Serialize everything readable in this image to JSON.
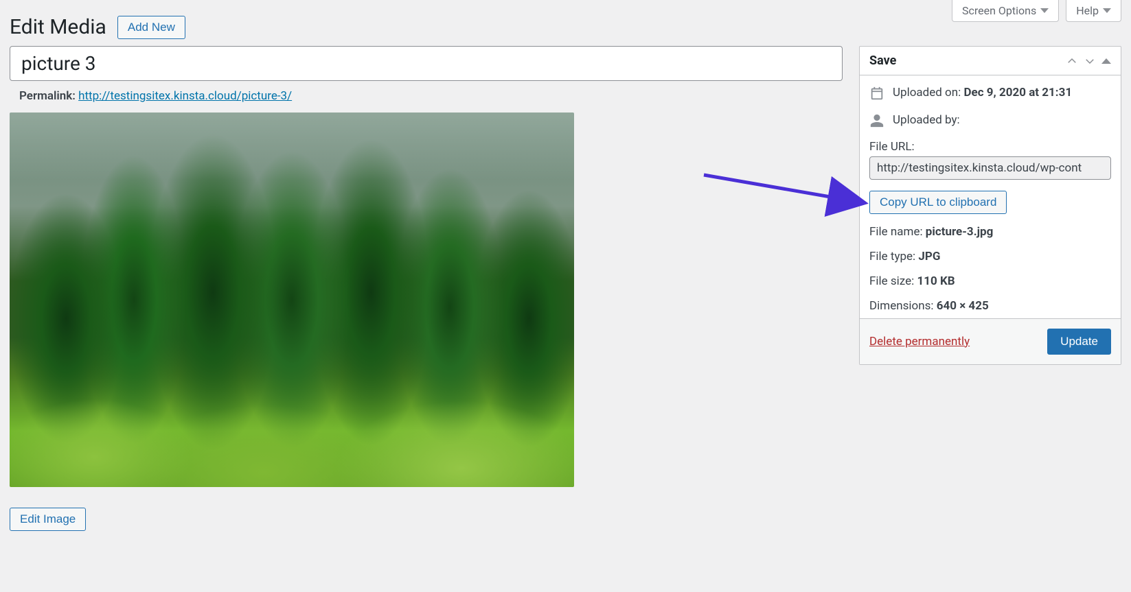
{
  "top": {
    "screen_options": "Screen Options",
    "help": "Help"
  },
  "header": {
    "title": "Edit Media",
    "add_new": "Add New"
  },
  "post": {
    "title_value": "picture 3",
    "permalink_label": "Permalink:",
    "permalink_url": "http://testingsitex.kinsta.cloud/picture-3/",
    "edit_image": "Edit Image"
  },
  "save_panel": {
    "title": "Save",
    "uploaded_on_label": "Uploaded on:",
    "uploaded_on_value": "Dec 9, 2020 at 21:31",
    "uploaded_by_label": "Uploaded by:",
    "file_url_label": "File URL:",
    "file_url_value": "http://testingsitex.kinsta.cloud/wp-cont",
    "copy_url": "Copy URL to clipboard",
    "file_name_label": "File name:",
    "file_name_value": "picture-3.jpg",
    "file_type_label": "File type:",
    "file_type_value": "JPG",
    "file_size_label": "File size:",
    "file_size_value": "110 KB",
    "dimensions_label": "Dimensions:",
    "dimensions_value": "640 × 425",
    "delete": "Delete permanently",
    "update": "Update"
  }
}
